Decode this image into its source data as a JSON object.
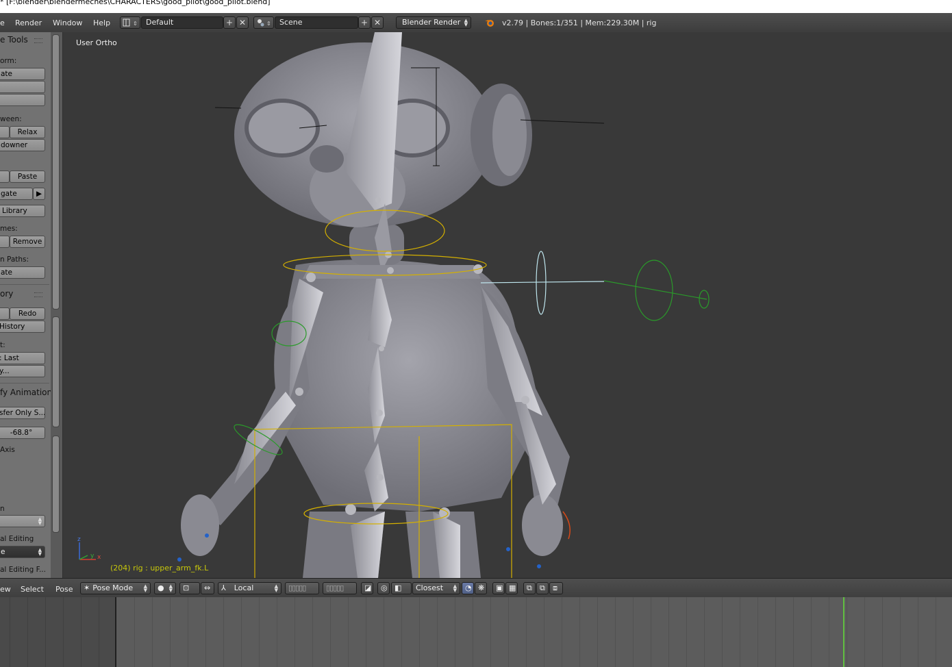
{
  "window": {
    "title": "* [F:\\blender\\blendermeches\\CHARACTERS\\good_pilot\\good_pilot.blend]"
  },
  "info_header": {
    "menus": [
      "e",
      "Render",
      "Window",
      "Help"
    ],
    "screen_layout": "Default",
    "scene": "Scene",
    "render_engine": "Blender Render",
    "stats": "v2.79 | Bones:1/351  | Mem:229.30M | rig"
  },
  "tool_shelf": {
    "header": "e Tools",
    "transform_label": "orm:",
    "translate_btn": "ate",
    "inbetween_label": "ween:",
    "relax_btn": "Relax",
    "breakdowner_btn": "downer",
    "paste_btn": "Paste",
    "propagate_btn": "gate",
    "library_btn": "Library",
    "keyframes_label": "mes:",
    "remove_btn": "Remove",
    "motion_paths_label": "n Paths:",
    "calculate_btn": "ate",
    "history_header": "ory",
    "redo_btn": "Redo",
    "history_btn": "History",
    "repeat_label": "t:",
    "repeat_last_btn": ": Last",
    "repeat_history_btn": "y...",
    "animation_header": "fy Animation",
    "transfer_btn": "sfer Only S...",
    "angle_value": "-68.8°",
    "axis_label": "Axis",
    "n_label": "n",
    "editing_label": "al Editing",
    "editing_fall_label": "al Editing F..."
  },
  "viewport": {
    "view_label": "User Ortho",
    "object_info": "(204) rig : upper_arm_fk.L",
    "axis_x": "x",
    "axis_y": "y",
    "axis_z": "z"
  },
  "view3d_header": {
    "menus": [
      "ew",
      "Select",
      "Pose"
    ],
    "mode": "Pose Mode",
    "transform_orientation": "Local",
    "snap_target": "Closest"
  },
  "timeline": {
    "current_frame_marker": "frame-cursor"
  },
  "colors": {
    "panel_bg": "#727272",
    "viewport_bg": "#393939",
    "rig_text": "#c8c80a",
    "bone_select": "#d4b000",
    "ik_circle": "#2a9a2a",
    "frame_cursor": "#60c040"
  }
}
